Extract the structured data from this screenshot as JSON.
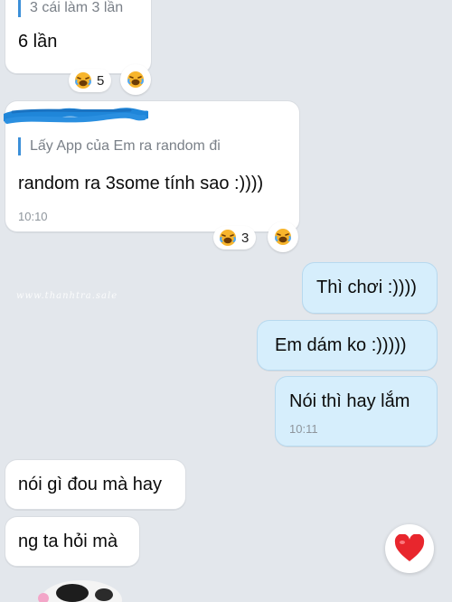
{
  "messages": [
    {
      "quote": "3 cái làm 3 lần",
      "text": "6 lần",
      "reaction_count": "5"
    },
    {
      "quote": "Lấy App của Em ra random đi",
      "text": "random ra 3some tính sao :))))",
      "time": "10:10",
      "reaction_count": "3"
    },
    {
      "text": "Thì chơi :))))"
    },
    {
      "text": "Em dám ko :)))))"
    },
    {
      "text": "Nói thì hay lắm",
      "time": "10:11"
    },
    {
      "text": "nói gì đou mà hay"
    },
    {
      "text": "ng ta hỏi mà"
    }
  ],
  "watermark": "www.thanhtra.sale",
  "icons": {
    "reaction": "laughing-crying-face-icon",
    "quick_react": "heart-icon"
  },
  "colors": {
    "background": "#e3e7ec",
    "incoming_bubble": "#ffffff",
    "outgoing_bubble": "#d6eefc",
    "quote_bar": "#3c8fd8",
    "heart": "#e8262d"
  }
}
